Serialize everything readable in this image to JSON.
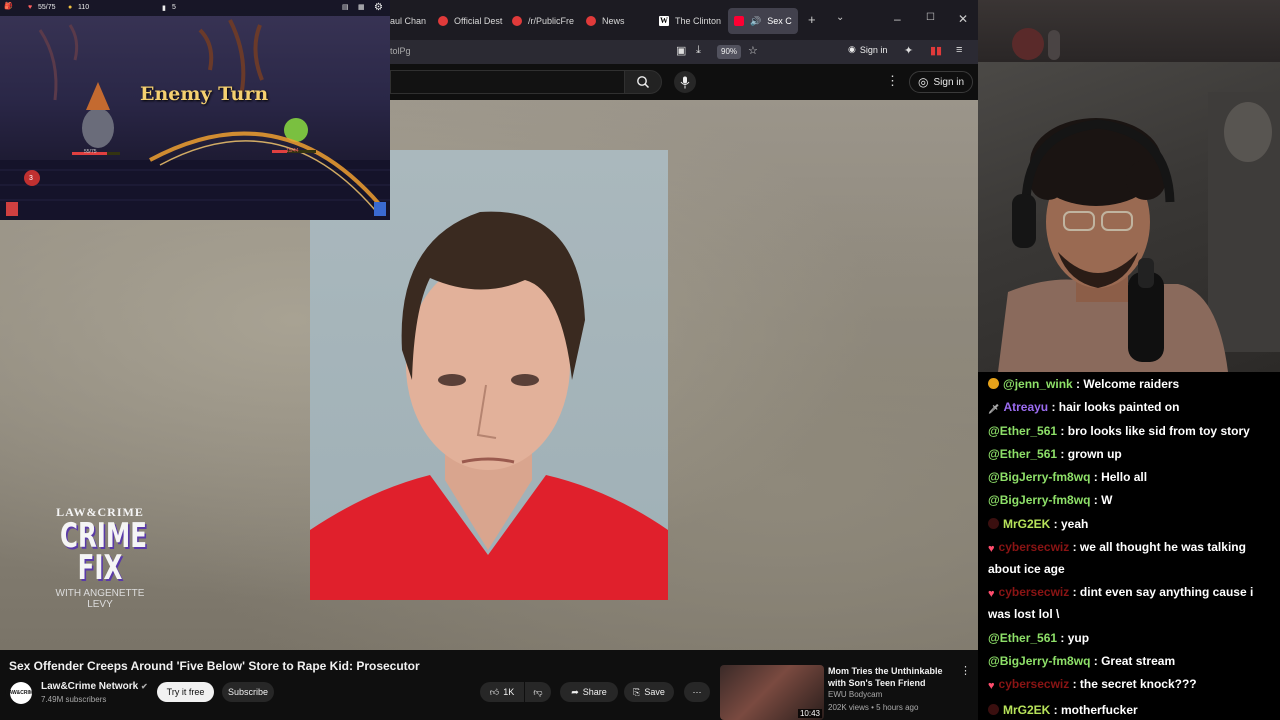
{
  "browser": {
    "tabs": [
      {
        "label": "aul Chan",
        "favicon": "red-circle"
      },
      {
        "label": "Official Dest",
        "favicon": "red-circle"
      },
      {
        "label": "/r/PublicFre",
        "favicon": "red-circle"
      },
      {
        "label": "News",
        "favicon": "red-circle"
      },
      {
        "label": "The Clinton",
        "favicon": "wikipedia-w"
      },
      {
        "label": "Sex C",
        "favicon": "youtube",
        "active": true
      }
    ],
    "url_fragment": "tolPg",
    "zoom": "90%",
    "sign_in": "Sign in"
  },
  "youtube": {
    "header_sign_in": "Sign in",
    "video_title": "Sex Offender Creeps Around 'Five Below' Store to Rape Kid: Prosecutor",
    "channel": {
      "avatar_text": "LAW&CRIME",
      "name": "Law&Crime Network",
      "subscribers": "7.49M subscribers"
    },
    "try_free_label": "Try it free",
    "subscribe_label": "Subscribe",
    "like_count": "1K",
    "share_label": "Share",
    "save_label": "Save",
    "overlay_logo": {
      "line1": "LAW&CRIME",
      "line2": "CRIME",
      "line3": "FIX",
      "line4": "WITH ANGENETTE LEVY"
    },
    "recommended": {
      "title": "Mom Tries the Unthinkable with Son's Teen Friend",
      "channel": "EWU Bodycam",
      "meta": "202K views • 5 hours ago",
      "duration": "10:43"
    }
  },
  "game": {
    "banner": "Enemy Turn",
    "hud_gold": "110",
    "hud_hp": "55/75",
    "hud_deck": "5",
    "enemy_hp": "55/75",
    "player_hp": "15/44",
    "badge": "3"
  },
  "chat": {
    "messages": [
      {
        "user": "@jenn_wink",
        "color": "#8ee069",
        "text": " : Welcome raiders",
        "badge": "gold"
      },
      {
        "user": "Atreayu",
        "color": "#9b6cf0",
        "text": " : hair looks painted on",
        "badge": "mod"
      },
      {
        "user": "@Ether_561",
        "color": "#8ee069",
        "text": " : bro looks like sid from toy story",
        "badge": ""
      },
      {
        "user": "@Ether_561",
        "color": "#8ee069",
        "text": " : grown up",
        "badge": ""
      },
      {
        "user": "@BigJerry-fm8wq",
        "color": "#8ee069",
        "text": " : Hello all",
        "badge": ""
      },
      {
        "user": "@BigJerry-fm8wq",
        "color": "#8ee069",
        "text": " : W",
        "badge": ""
      },
      {
        "user": "MrG2EK",
        "color": "#b7e25a",
        "text": " : yeah",
        "badge": "dot"
      },
      {
        "user": "cybersecwiz",
        "color": "#8a1414",
        "text": " : we all thought he was talking about ice age",
        "badge": "heart"
      },
      {
        "user": "cybersecwiz",
        "color": "#8a1414",
        "text": " : dint even say anything cause i was lost lol \\",
        "badge": "heart"
      },
      {
        "user": "@Ether_561",
        "color": "#8ee069",
        "text": " : yup",
        "badge": ""
      },
      {
        "user": "@BigJerry-fm8wq",
        "color": "#8ee069",
        "text": " : Great stream",
        "badge": ""
      },
      {
        "user": "cybersecwiz",
        "color": "#8a1414",
        "text": " : the secret knock???",
        "badge": "heart"
      },
      {
        "user": "MrG2EK",
        "color": "#b7e25a",
        "text": " : motherfucker",
        "badge": "dot"
      }
    ]
  }
}
